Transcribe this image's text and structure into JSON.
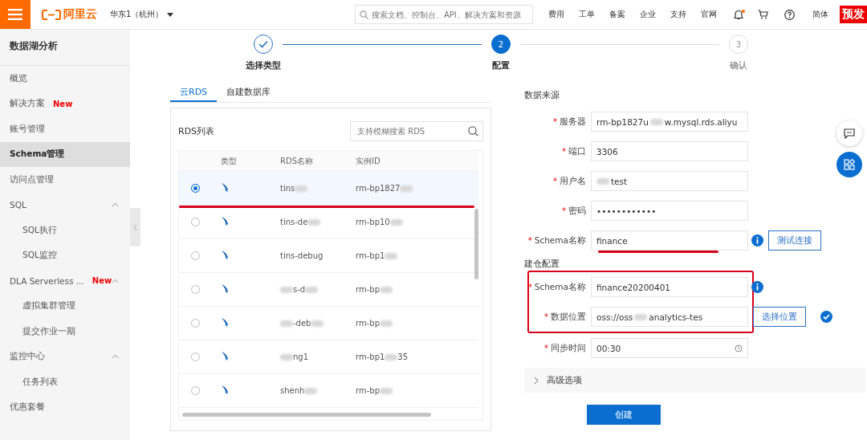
{
  "header": {
    "logo": "阿里云",
    "region": "华东1（杭州）",
    "search": {
      "placeholder": "搜索文档、控制台、API、解决方案和资源"
    },
    "nav": [
      "费用",
      "工单",
      "备案",
      "企业",
      "支持",
      "官网"
    ],
    "notification_dot": true,
    "language": "简体",
    "env_badge": "预发"
  },
  "sidebar": {
    "title": "数据湖分析",
    "items": [
      {
        "label": "概览",
        "selected": false
      },
      {
        "label": "解决方案",
        "badge": "New",
        "selected": false
      },
      {
        "label": "账号管理",
        "selected": false
      },
      {
        "label": "Schema管理",
        "selected": true
      },
      {
        "label": "访问点管理",
        "selected": false
      },
      {
        "label": "SQL",
        "selected": false,
        "expanded": true,
        "children": [
          {
            "label": "SQL执行",
            "selected": false
          },
          {
            "label": "SQL监控",
            "selected": false
          }
        ]
      },
      {
        "label": "DLA Serverless ...",
        "badge": "New",
        "selected": false,
        "expanded": true,
        "children": [
          {
            "label": "虚拟集群管理",
            "selected": false
          },
          {
            "label": "提交作业一期",
            "selected": false
          }
        ]
      },
      {
        "label": "监控中心",
        "selected": false,
        "expanded": true,
        "children": [
          {
            "label": "任务列表",
            "selected": false
          }
        ]
      },
      {
        "label": "优惠套餐",
        "selected": false
      }
    ]
  },
  "steps": [
    {
      "label": "选择类型",
      "completed": true,
      "selected": false
    },
    {
      "label": "配置",
      "number": "2",
      "completed": false,
      "selected": true
    },
    {
      "label": "确认",
      "number": "3",
      "completed": false,
      "selected": false
    }
  ],
  "tabs": [
    {
      "label": "云RDS",
      "selected": true
    },
    {
      "label": "自建数据库",
      "selected": false
    }
  ],
  "rds_list": {
    "title": "RDS列表",
    "search": {
      "placeholder": "支持模糊搜索 RDS"
    },
    "columns": [
      "类型",
      "RDS名称",
      "实例ID"
    ],
    "rows": [
      {
        "selected": true,
        "name": [
          {
            "kind": "text",
            "text": "tins"
          },
          {
            "kind": "blur"
          }
        ],
        "id": [
          {
            "kind": "text",
            "text": "rm-bp1827"
          },
          {
            "kind": "blur"
          }
        ]
      },
      {
        "selected": false,
        "name": [
          {
            "kind": "text",
            "text": "tins-de"
          },
          {
            "kind": "blur"
          }
        ],
        "id": [
          {
            "kind": "text",
            "text": "rm-bp10"
          },
          {
            "kind": "blur"
          }
        ]
      },
      {
        "selected": false,
        "name": [
          {
            "kind": "text",
            "text": "tins-debug"
          }
        ],
        "id": [
          {
            "kind": "text",
            "text": "rm-bp1"
          },
          {
            "kind": "blur"
          }
        ]
      },
      {
        "selected": false,
        "name": [
          {
            "kind": "blur"
          },
          {
            "kind": "text",
            "text": "s-d"
          },
          {
            "kind": "blur"
          }
        ],
        "id": [
          {
            "kind": "text",
            "text": "rm-bp"
          },
          {
            "kind": "blur"
          }
        ]
      },
      {
        "selected": false,
        "name": [
          {
            "kind": "blur"
          },
          {
            "kind": "text",
            "text": "-deb"
          },
          {
            "kind": "blur"
          }
        ],
        "id": [
          {
            "kind": "text",
            "text": "rm-bp"
          },
          {
            "kind": "blur"
          }
        ]
      },
      {
        "selected": false,
        "name": [
          {
            "kind": "blur"
          },
          {
            "kind": "text",
            "text": "ng1"
          }
        ],
        "id": [
          {
            "kind": "text",
            "text": "rm-bp1"
          },
          {
            "kind": "blur"
          },
          {
            "kind": "text",
            "text": "35"
          }
        ]
      },
      {
        "selected": false,
        "name": [
          {
            "kind": "text",
            "text": "shenh"
          },
          {
            "kind": "blur"
          }
        ],
        "id": [
          {
            "kind": "text",
            "text": "rm-bp"
          },
          {
            "kind": "blur"
          }
        ]
      }
    ]
  },
  "data_source": {
    "title": "数据来源",
    "fields": [
      {
        "required_mark": "*",
        "label": "服务器",
        "value": [
          {
            "kind": "text",
            "text": "rm-bp1827u"
          },
          {
            "kind": "blur"
          },
          {
            "kind": "text",
            "text": "w.mysql.rds.aliyu"
          }
        ]
      },
      {
        "required_mark": "*",
        "label": "端口",
        "value": [
          {
            "kind": "text",
            "text": "3306"
          }
        ]
      },
      {
        "required_mark": "*",
        "label": "用户名",
        "value": [
          {
            "kind": "blur"
          },
          {
            "kind": "text",
            "text": "test"
          }
        ]
      },
      {
        "required_mark": "*",
        "label": "密码",
        "value": [
          {
            "kind": "text",
            "text": "••••••••••••"
          }
        ]
      },
      {
        "required_mark": "*",
        "label": "Schema名称",
        "value": [
          {
            "kind": "text",
            "text": "finance"
          }
        ],
        "info": true,
        "button": "测试连接"
      }
    ]
  },
  "warehouse": {
    "title": "建仓配置",
    "fields": [
      {
        "required_mark": "*",
        "label": "Schema名称",
        "value": [
          {
            "kind": "text",
            "text": "finance20200401"
          }
        ],
        "info": true
      },
      {
        "required_mark": "*",
        "label": "数据位置",
        "value": [
          {
            "kind": "text",
            "text": "oss://oss"
          },
          {
            "kind": "blur"
          },
          {
            "kind": "text",
            "text": "analytics-tes"
          }
        ],
        "button": "选择位置",
        "verified": true
      },
      {
        "required_mark": "*",
        "label": "同步时间",
        "value": [
          {
            "kind": "text",
            "text": "00:30"
          }
        ],
        "clock": true
      }
    ]
  },
  "advanced": {
    "label": "高级选项",
    "expanded": false
  },
  "submit": "创建"
}
